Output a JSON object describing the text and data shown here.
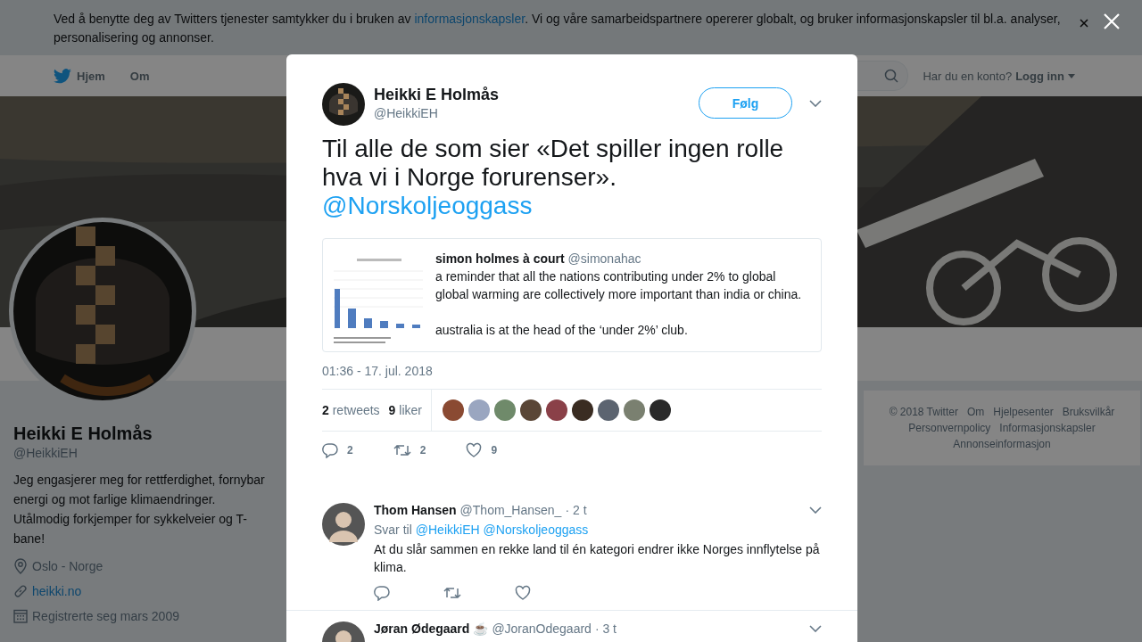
{
  "cookie_banner": {
    "text_before": "Ved å benytte deg av Twitters tjenester samtykker du i bruken av ",
    "link": "informasjonskapsler",
    "text_after": ". Vi og våre samarbeidspartnere opererer globalt, og bruker informasjonskapsler til bl.a. analyser, personalisering og annonser."
  },
  "nav": {
    "items": [
      {
        "label": "Hjem"
      },
      {
        "label": "Om"
      }
    ],
    "login_prompt": "Har du en konto?",
    "login_link": "Logg inn"
  },
  "profile": {
    "name": "Heikki E Holmås",
    "handle": "@HeikkiEH",
    "bio": "Jeg engasjerer meg for rettferdighet, fornybar energi og mot farlige klimaendringer. Utålmodig forkjemper for sykkelveier og T-bane!",
    "location": "Oslo - Norge",
    "website": "heikki.no",
    "joined": "Registrerte seg mars 2009"
  },
  "footer_links": [
    "© 2018 Twitter",
    "Om",
    "Hjelpesenter",
    "Bruksvilkår",
    "Personvernpolicy",
    "Informasjonskapsler",
    "Annonseinformasjon"
  ],
  "tweet": {
    "name": "Heikki E Holmås",
    "handle": "@HeikkiEH",
    "follow": "Følg",
    "text": "Til alle de som sier «Det spiller ingen rolle hva vi i Norge forurenser».",
    "mention": "@Norskoljeoggass",
    "quote": {
      "name": "simon holmes à court",
      "handle": "@simonahac",
      "paragraphs": [
        "a reminder that all the nations contributing under 2% to global global warming are collectively more important than india or china.",
        "australia is at the head of the ‘under 2%’ club."
      ]
    },
    "time": "01:36 - 17. jul. 2018",
    "stats": [
      {
        "count": "2",
        "label": "retweets"
      },
      {
        "count": "9",
        "label": "liker"
      }
    ],
    "likers": [
      {
        "color": "#8a4a32"
      },
      {
        "color": "#9aa6c0"
      },
      {
        "color": "#6f8a6a"
      },
      {
        "color": "#5a4636"
      },
      {
        "color": "#8a4048"
      },
      {
        "color": "#3a2c22"
      },
      {
        "color": "#5c6470"
      },
      {
        "color": "#7a8070"
      },
      {
        "color": "#2a2a2a"
      }
    ],
    "actions": [
      {
        "kind": "reply",
        "count": "2"
      },
      {
        "kind": "retweet",
        "count": "2"
      },
      {
        "kind": "like",
        "count": "9"
      }
    ]
  },
  "replies": [
    {
      "name": "Thom Hansen",
      "handle": "@Thom_Hansen_",
      "time": "· 2 t",
      "reply_prefix": "Svar til",
      "reply_to": [
        "@HeikkiEH",
        "@Norskoljeoggass"
      ],
      "text": "At du slår sammen en rekke land til én kategori endrer ikke Norges innflytelse på klima.",
      "actions": [
        {
          "kind": "reply"
        },
        {
          "kind": "retweet"
        },
        {
          "kind": "like"
        }
      ]
    },
    {
      "name": "Jøran Ødegaard",
      "emoji": "☕",
      "handle": "@JoranOdegaard",
      "time": "· 3 t"
    }
  ]
}
